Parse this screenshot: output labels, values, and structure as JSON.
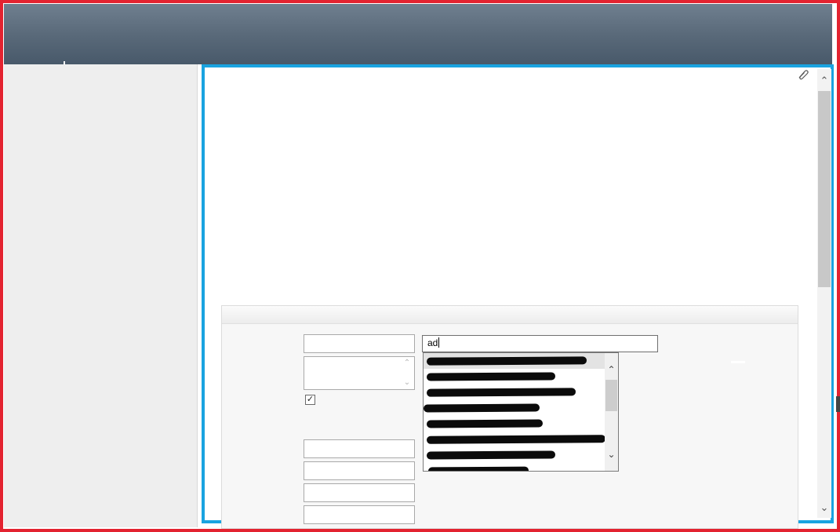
{
  "search": {
    "value": "ad"
  },
  "form": {
    "checkbox_checked": true,
    "checkbox_glyph": "✓"
  },
  "icons": {
    "attach": "paperclip-icon",
    "scroll_up": "chevron-up-icon",
    "scroll_down": "chevron-down-icon"
  },
  "colors": {
    "outer_border": "#e32330",
    "highlight_border": "#1aa3e0",
    "header_top": "#6f7f8f",
    "header_bottom": "#48596a"
  },
  "scroll_glyphs": {
    "up": "⌃",
    "down": "⌄"
  },
  "suggestions_count": 8
}
